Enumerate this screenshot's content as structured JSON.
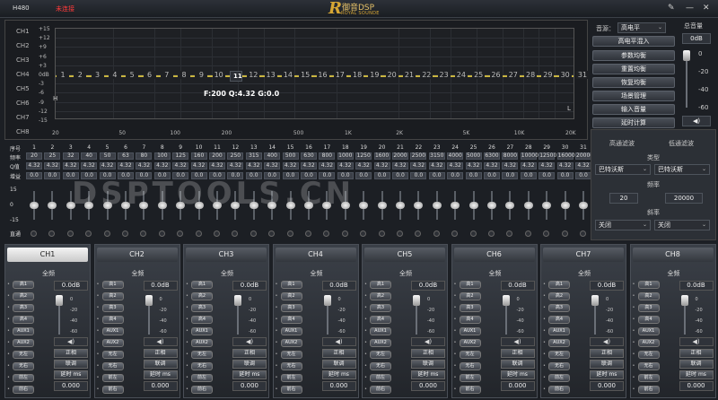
{
  "header": {
    "model": "H480",
    "status": "未连接",
    "logo_mark": "R",
    "logo_cn": "御音DSP",
    "logo_en": "ROYAL SOUNDE",
    "icons": [
      "wrench-icon",
      "minimize-icon",
      "close-icon"
    ]
  },
  "graph": {
    "channels": [
      "CH1",
      "CH2",
      "CH3",
      "CH4",
      "CH5",
      "CH6",
      "CH7",
      "CH8"
    ],
    "y_ticks": [
      "+15",
      "+12",
      "+9",
      "+6",
      "+3",
      "0dB",
      "-3",
      "-6",
      "-9",
      "-12",
      "-15"
    ],
    "bands": [
      "1",
      "2",
      "3",
      "4",
      "5",
      "6",
      "7",
      "8",
      "9",
      "10",
      "11",
      "12",
      "13",
      "14",
      "15",
      "16",
      "17",
      "18",
      "19",
      "20",
      "21",
      "22",
      "23",
      "24",
      "25",
      "26",
      "27",
      "28",
      "29",
      "30",
      "31"
    ],
    "selected_band": "11",
    "info": "F:200 Q:4.32 G:0.0",
    "x_ticks": [
      "20",
      "50",
      "100",
      "200",
      "500",
      "1K",
      "2K",
      "5K",
      "10K",
      "20K"
    ],
    "h_mark": "H",
    "l_mark": "L"
  },
  "table": {
    "row_labels": [
      "序号",
      "频率",
      "Q值",
      "增益",
      "15",
      "0",
      "-15",
      "直通"
    ],
    "freqs": [
      "20",
      "25",
      "32",
      "40",
      "50",
      "63",
      "80",
      "100",
      "125",
      "160",
      "200",
      "250",
      "315",
      "400",
      "500",
      "630",
      "800",
      "1000",
      "1250",
      "1600",
      "2000",
      "2500",
      "3150",
      "4000",
      "5000",
      "6300",
      "8000",
      "10000",
      "12500",
      "16000",
      "20000"
    ],
    "q": "4.32",
    "gain": "0.0"
  },
  "right": {
    "source_label": "音源：",
    "source_value": "高电平",
    "highlevel_btn": "高电平混入",
    "master_label": "总音量",
    "master_value": "0dB",
    "master_scale": [
      "0",
      "-20",
      "-40",
      "-60"
    ],
    "buttons": [
      "参数均衡",
      "重置均衡",
      "恢复均衡",
      "场景管理",
      "输入音量",
      "延时计算"
    ],
    "hp_label": "高通滤波",
    "lp_label": "低通滤波",
    "type_label": "类型",
    "hp_type": "巴特沃斯",
    "lp_type": "巴特沃斯",
    "freq_label": "频率",
    "hp_freq": "20",
    "lp_freq": "20000",
    "slope_label": "斜率",
    "hp_slope": "关闭",
    "lp_slope": "关闭"
  },
  "channels": [
    {
      "name": "CH1",
      "gain": "0.0dB",
      "vol": "0.000"
    },
    {
      "name": "CH2",
      "gain": "0.0dB",
      "vol": "0.000"
    },
    {
      "name": "CH3",
      "gain": "0.0dB",
      "vol": "0.000"
    },
    {
      "name": "CH4",
      "gain": "0.0dB",
      "vol": "0.000"
    },
    {
      "name": "CH5",
      "gain": "0.0dB",
      "vol": "0.000"
    },
    {
      "name": "CH6",
      "gain": "0.0dB",
      "vol": "0.000"
    },
    {
      "name": "CH7",
      "gain": "0.0dB",
      "vol": "0.000"
    },
    {
      "name": "CH8",
      "gain": "0.0dB",
      "vol": "0.000"
    }
  ],
  "channel_common": {
    "passthrough": "全频",
    "inputs": [
      "高1",
      "高2",
      "高3",
      "高4",
      "AUX1",
      "AUX2",
      "无左",
      "无右",
      "前左",
      "前右"
    ],
    "scale": [
      "0",
      "-20",
      "-40",
      "-60"
    ],
    "phase": "正相",
    "link": "联调",
    "delay": "延时 ms"
  },
  "watermark": "DSPTOOLS.CN"
}
